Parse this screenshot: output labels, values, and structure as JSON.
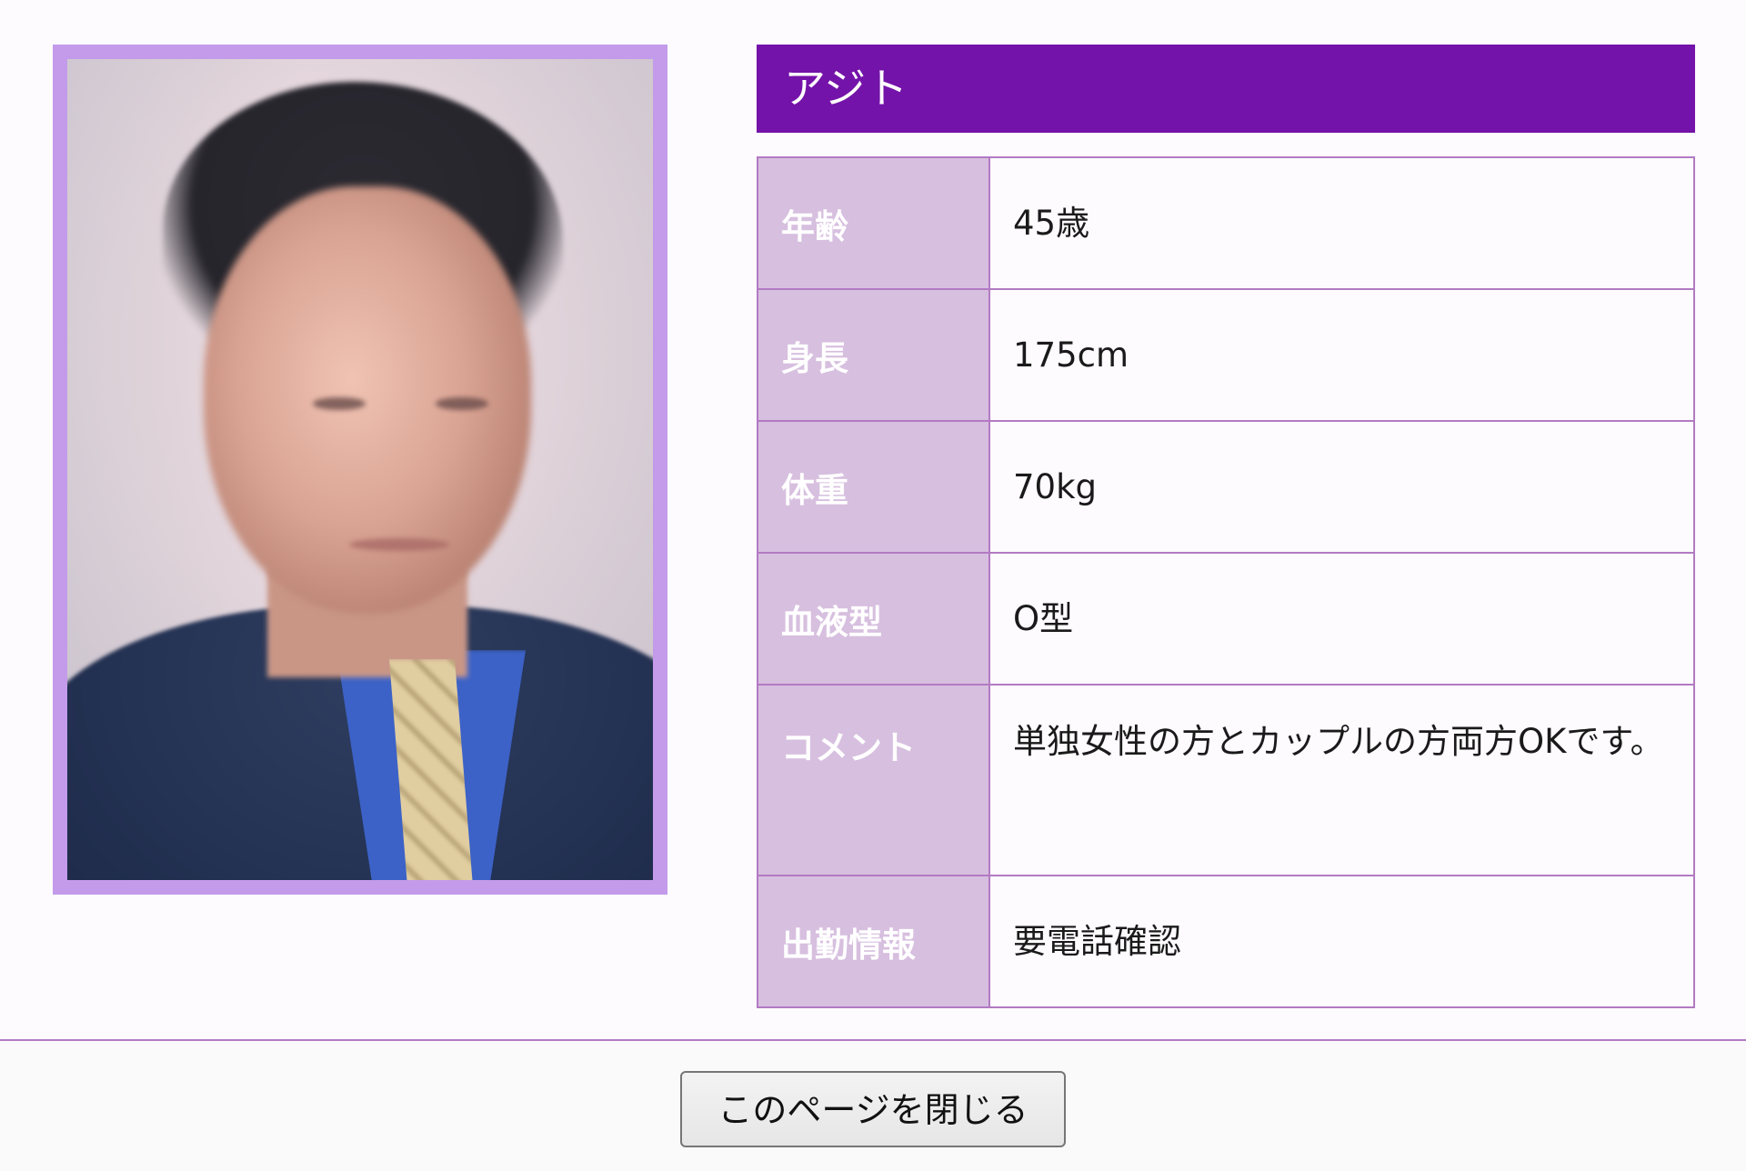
{
  "profile": {
    "name": "アジト",
    "photo_alt": "profile-photo",
    "rows": [
      {
        "label": "年齢",
        "value": "45歳"
      },
      {
        "label": "身長",
        "value": "175cm"
      },
      {
        "label": "体重",
        "value": "70kg"
      },
      {
        "label": "血液型",
        "value": "O型"
      },
      {
        "label": "コメント",
        "value": "単独女性の方とカップルの方両方OKです。"
      },
      {
        "label": "出勤情報",
        "value": "要電話確認"
      }
    ]
  },
  "footer": {
    "close_label": "このページを閉じる"
  },
  "colors": {
    "accent": "#7413a9",
    "label_bg": "#d7bfdf",
    "border": "#b27ac3",
    "photo_frame": "#c39bea"
  }
}
